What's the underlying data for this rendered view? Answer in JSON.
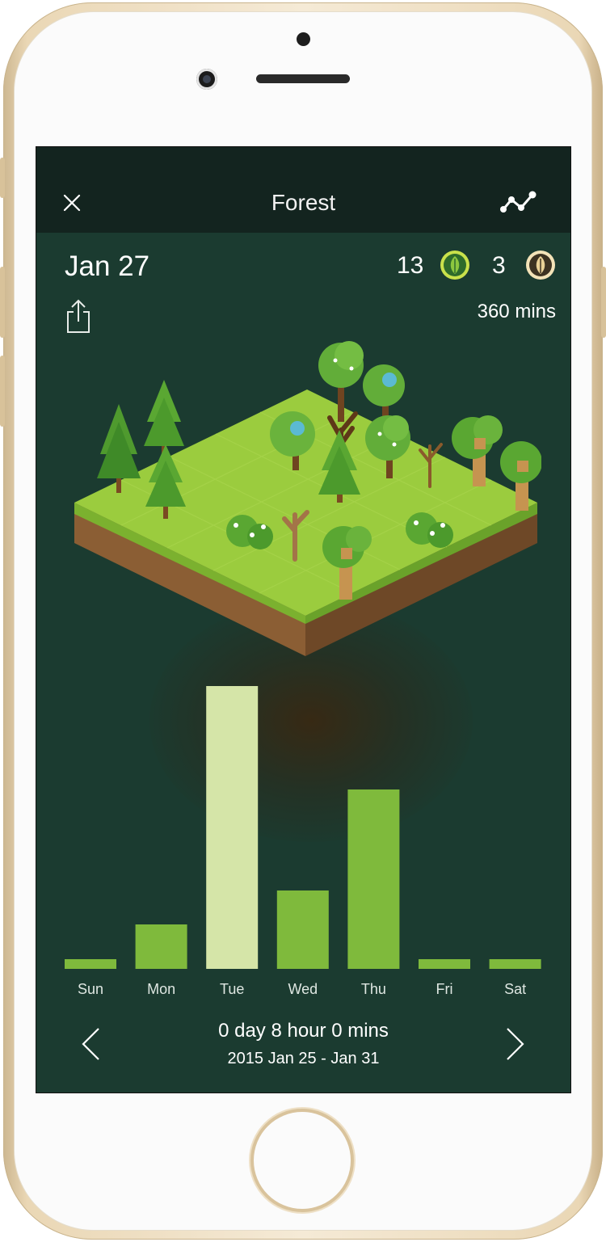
{
  "header": {
    "title": "Forest",
    "close_icon": "close-icon",
    "stats_icon": "line-chart-icon"
  },
  "summary_top": {
    "date": "Jan 27",
    "healthy_trees": "13",
    "withered_trees": "3",
    "minutes": "360 mins",
    "share_icon": "share-icon"
  },
  "colors": {
    "background": "#1b3b30",
    "navbar": "#13241f",
    "bar": "#7fba3c",
    "bar_selected": "#d5e5a8",
    "healthy_badge": "#8dc63f",
    "withered_badge": "#e9d196"
  },
  "chart_data": {
    "type": "bar",
    "categories": [
      "Sun",
      "Mon",
      "Tue",
      "Wed",
      "Thu",
      "Fri",
      "Sat"
    ],
    "values": [
      12,
      55,
      350,
      97,
      222,
      12,
      12
    ],
    "selected_index": 2,
    "ylim": [
      0,
      350
    ],
    "grid": false
  },
  "footer": {
    "total": "0 day 8 hour 0 mins",
    "range": "2015 Jan 25 - Jan 31",
    "prev_icon": "chevron-left-icon",
    "next_icon": "chevron-right-icon"
  }
}
